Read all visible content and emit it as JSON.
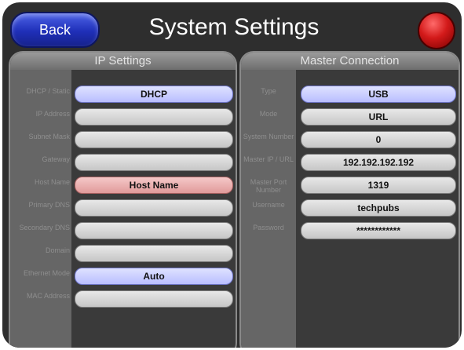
{
  "header": {
    "back_label": "Back",
    "title": "System Settings"
  },
  "ip_settings": {
    "title": "IP Settings",
    "rows": [
      {
        "label": "DHCP / Static",
        "value": "DHCP",
        "style": "blue"
      },
      {
        "label": "IP Address",
        "value": "",
        "style": "gray"
      },
      {
        "label": "Subnet Mask",
        "value": "",
        "style": "gray"
      },
      {
        "label": "Gateway",
        "value": "",
        "style": "gray"
      },
      {
        "label": "Host Name",
        "value": "Host Name",
        "style": "pink"
      },
      {
        "label": "Primary DNS",
        "value": "",
        "style": "gray"
      },
      {
        "label": "Secondary DNS",
        "value": "",
        "style": "gray"
      },
      {
        "label": "Domain",
        "value": "",
        "style": "gray"
      },
      {
        "label": "Ethernet Mode",
        "value": "Auto",
        "style": "blue"
      },
      {
        "label": "MAC Address",
        "value": "",
        "style": "gray"
      }
    ]
  },
  "master_connection": {
    "title": "Master Connection",
    "rows": [
      {
        "label": "Type",
        "value": "USB",
        "style": "blue"
      },
      {
        "label": "Mode",
        "value": "URL",
        "style": "gray"
      },
      {
        "label": "System Number",
        "value": "0",
        "style": "gray"
      },
      {
        "label": "Master IP / URL",
        "value": "192.192.192.192",
        "style": "gray"
      },
      {
        "label": "Master Port Number",
        "value": "1319",
        "style": "gray"
      },
      {
        "label": "Username",
        "value": "techpubs",
        "style": "gray"
      },
      {
        "label": "Password",
        "value": "************",
        "style": "gray"
      }
    ]
  }
}
